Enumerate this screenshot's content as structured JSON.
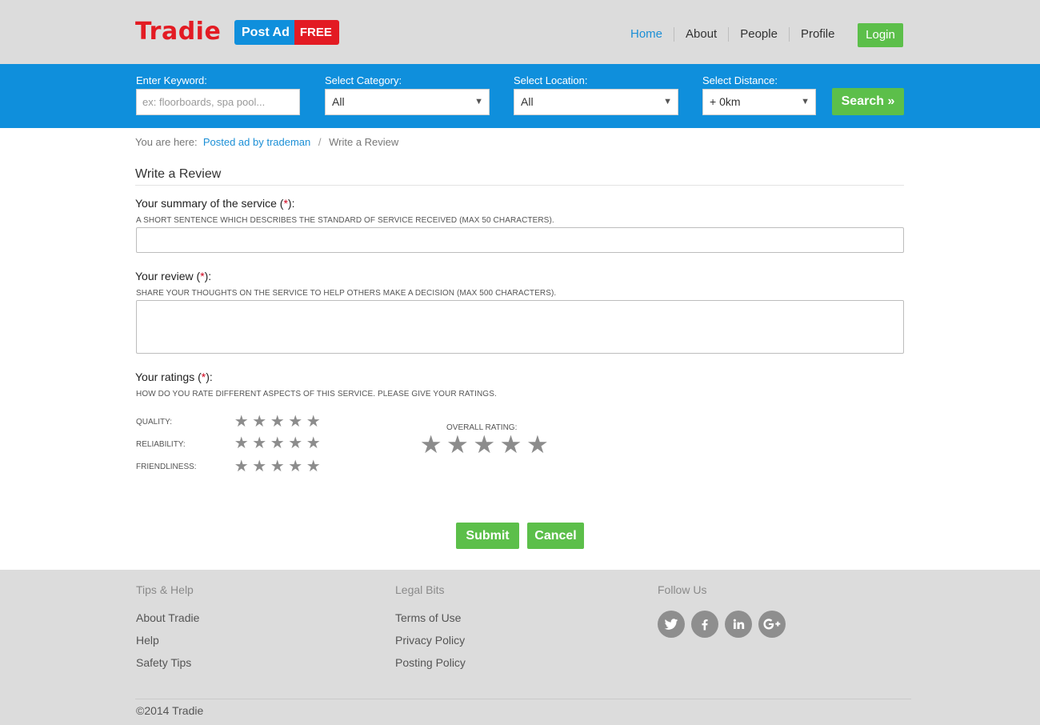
{
  "header": {
    "logo": "Tradie",
    "post_ad": "Post Ad",
    "free": "FREE",
    "nav": [
      "Home",
      "About",
      "People",
      "Profile"
    ],
    "login": "Login"
  },
  "search": {
    "keyword_label": "Enter Keyword:",
    "keyword_placeholder": "ex: floorboards, spa pool...",
    "category_label": "Select Category:",
    "category_value": "All",
    "location_label": "Select Location:",
    "location_value": "All",
    "distance_label": "Select Distance:",
    "distance_value": "+ 0km",
    "search_button": "Search"
  },
  "breadcrumb": {
    "prefix": "You are here:",
    "link": "Posted ad by trademan",
    "separator": "/",
    "current": "Write a Review"
  },
  "form": {
    "title": "Write a Review",
    "summary_label": "Your summary of the service (",
    "summary_close": "):",
    "summary_help": "A short sentence which describes the standard of service received (max 50 characters).",
    "review_label": "Your review (",
    "review_close": "):",
    "review_help": "Share your thoughts on the service to help others make a decision (max 500 characters).",
    "ratings_label": "Your ratings (",
    "ratings_close": "):",
    "ratings_help": "How do you rate different aspects of this service. Please give your ratings.",
    "required_mark": "*",
    "rating_rows": [
      {
        "label": "Quality:",
        "value": 0
      },
      {
        "label": "Reliability:",
        "value": 0
      },
      {
        "label": "Friendliness:",
        "value": 0
      }
    ],
    "overall_label": "Overall Rating:",
    "overall_value": 0,
    "submit": "Submit",
    "cancel": "Cancel"
  },
  "footer": {
    "col1_title": "Tips & Help",
    "col1_links": [
      "About Tradie",
      "Help",
      "Safety Tips"
    ],
    "col2_title": "Legal Bits",
    "col2_links": [
      "Terms of Use",
      "Privacy Policy",
      "Posting Policy"
    ],
    "col3_title": "Follow Us",
    "social": [
      "twitter-icon",
      "facebook-icon",
      "linkedin-icon",
      "google-plus-icon"
    ],
    "copyright": "©2014 Tradie"
  },
  "colors": {
    "brand_red": "#e31b23",
    "brand_blue": "#0f8fdc",
    "button_green": "#5cbf4a",
    "star_gray": "#8c8c8c"
  }
}
